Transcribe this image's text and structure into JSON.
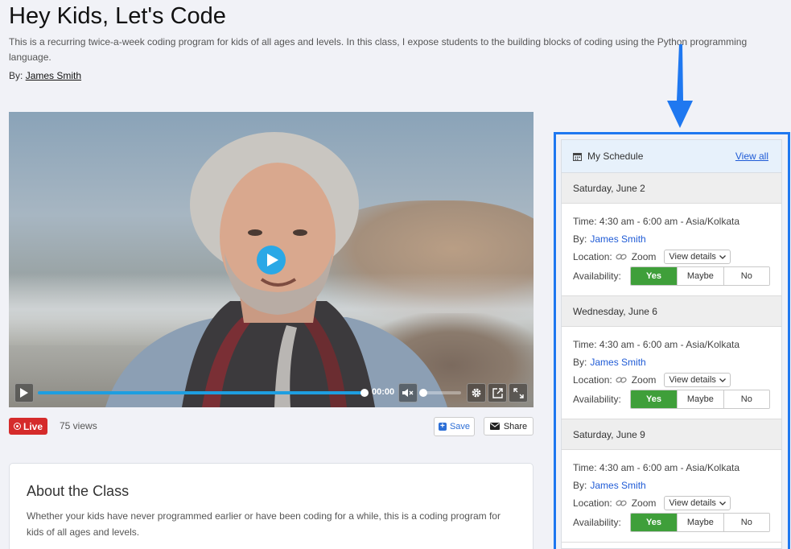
{
  "page": {
    "title": "Hey Kids, Let's Code",
    "description": "This is a recurring twice-a-week coding program for kids of all ages and levels. In this class, I expose students to the building blocks of coding using the Python programming language.",
    "by_label": "By:",
    "author": "James Smith"
  },
  "video": {
    "time": "00:00",
    "progress": 1.0,
    "volume": 0.0
  },
  "meta": {
    "live_label": "Live",
    "views": "75 views",
    "save_label": "Save",
    "share_label": "Share"
  },
  "about": {
    "heading": "About the Class",
    "text": "Whether your kids have never programmed earlier or have been coding for a while, this is a coding program for kids of all ages and levels."
  },
  "schedule": {
    "title": "My Schedule",
    "view_all": "View all",
    "time_label": "Time:",
    "by_label": "By:",
    "location_label": "Location:",
    "availability_label": "Availability:",
    "details_label": "View details",
    "options": [
      "Yes",
      "Maybe",
      "No"
    ],
    "days": [
      {
        "date": "Saturday, June 2",
        "time": "4:30 am - 6:00 am - Asia/Kolkata",
        "author": "James Smith",
        "location": "Zoom",
        "selected": "Yes"
      },
      {
        "date": "Wednesday, June 6",
        "time": "4:30 am - 6:00 am - Asia/Kolkata",
        "author": "James Smith",
        "location": "Zoom",
        "selected": "Yes"
      },
      {
        "date": "Saturday, June 9",
        "time": "4:30 am - 6:00 am - Asia/Kolkata",
        "author": "James Smith",
        "location": "Zoom",
        "selected": "Yes"
      }
    ]
  },
  "colors": {
    "accent": "#1f78f0",
    "live": "#d52b2b",
    "yes": "#3f9f3a",
    "link": "#1f5bd6",
    "progress": "#1e9ee0"
  }
}
